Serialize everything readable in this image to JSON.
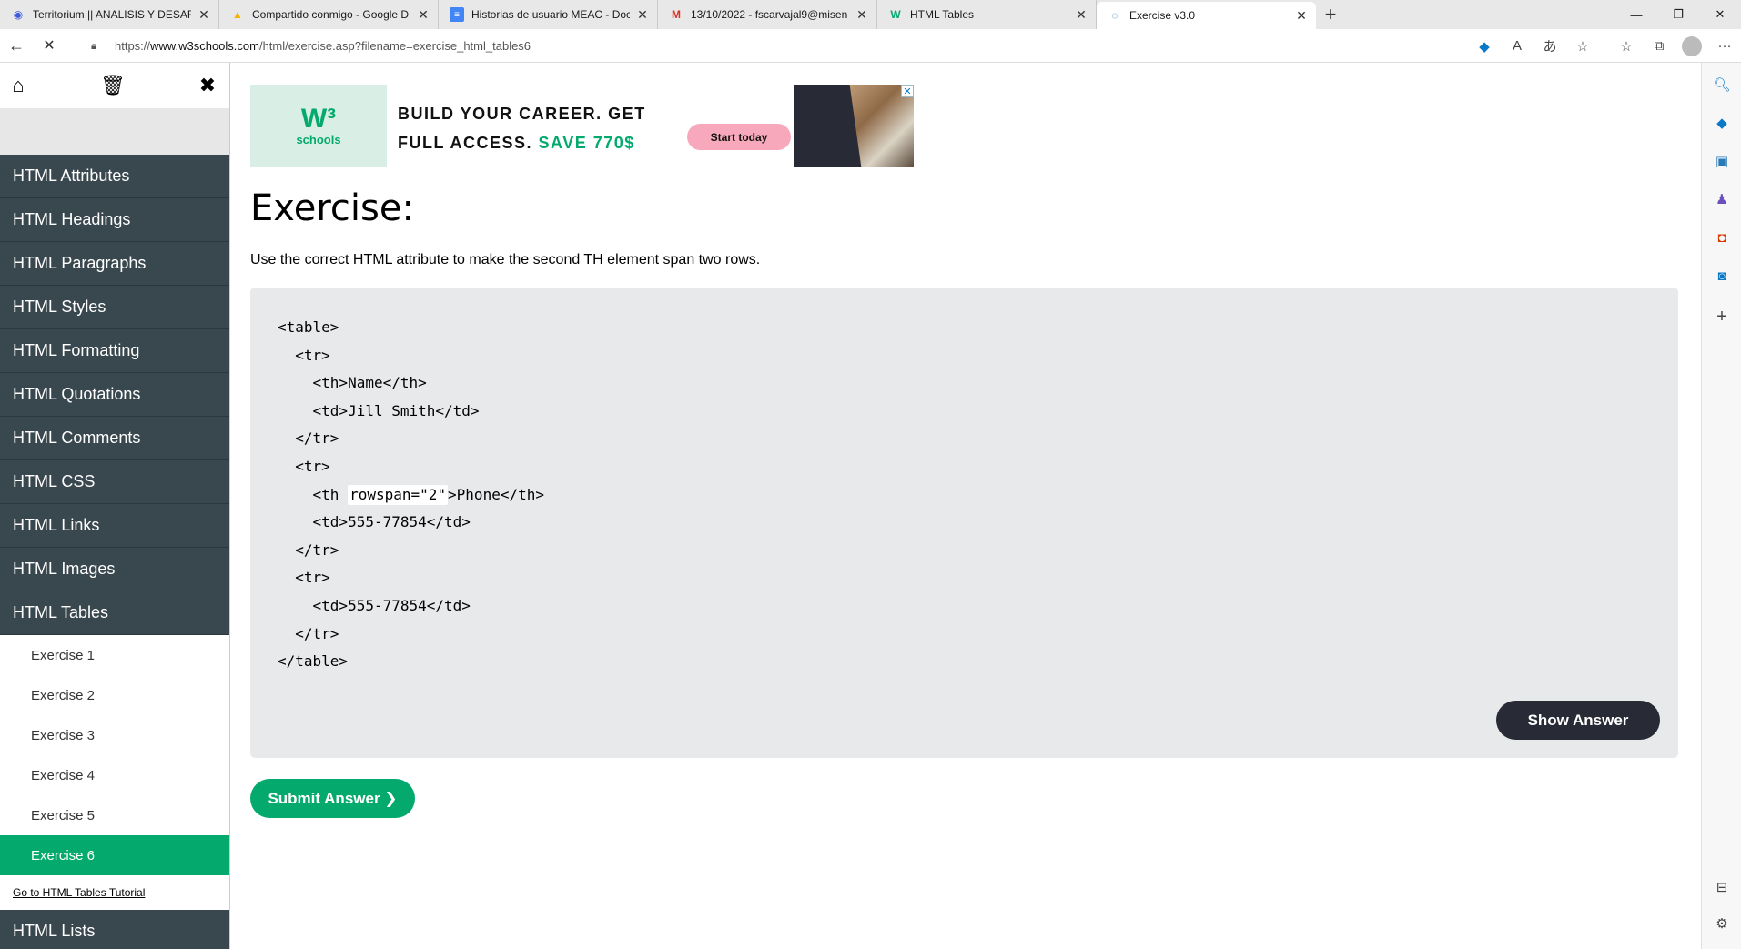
{
  "browser": {
    "tabs": [
      {
        "title": "Territorium || ANALISIS Y DESARR",
        "icon": "eye-icon"
      },
      {
        "title": "Compartido conmigo - Google D",
        "icon": "google-drive-icon"
      },
      {
        "title": "Historias de usuario MEAC - Doc",
        "icon": "google-docs-icon"
      },
      {
        "title": "13/10/2022 - fscarvajal9@misen",
        "icon": "gmail-icon"
      },
      {
        "title": "HTML Tables",
        "icon": "w3schools-icon"
      },
      {
        "title": "Exercise v3.0",
        "icon": "loading-icon"
      }
    ],
    "url_prefix": "https://",
    "url_host": "www.w3schools.com",
    "url_path": "/html/exercise.asp?filename=exercise_html_tables6"
  },
  "sidebar": {
    "sections": [
      "HTML Attributes",
      "HTML Headings",
      "HTML Paragraphs",
      "HTML Styles",
      "HTML Formatting",
      "HTML Quotations",
      "HTML Comments",
      "HTML CSS",
      "HTML Links",
      "HTML Images",
      "HTML Tables"
    ],
    "exercises": [
      "Exercise 1",
      "Exercise 2",
      "Exercise 3",
      "Exercise 4",
      "Exercise 5",
      "Exercise 6"
    ],
    "active_exercise": "Exercise 6",
    "goto_link": "Go to HTML Tables Tutorial",
    "next_section": "HTML Lists"
  },
  "ad": {
    "logo_text": "schools",
    "line1": "BUILD YOUR CAREER. GET",
    "line2_prefix": "FULL ACCESS.",
    "line2_save": "SAVE 770$",
    "cta": "Start today"
  },
  "exercise": {
    "title": "Exercise:",
    "description": "Use the correct HTML attribute to make the second TH element span two rows.",
    "code": {
      "l1": "<table>",
      "l2": "  <tr>",
      "l3": "    <th>Name</th>",
      "l4": "    <td>Jill Smith</td>",
      "l5": "  </tr>",
      "l6": "  <tr>",
      "l7_before": "    <th ",
      "l7_answer": "rowspan=\"2\"",
      "l7_after": ">Phone</th>",
      "l8": "    <td>555-77854</td>",
      "l9": "  </tr>",
      "l10": "  <tr>",
      "l11": "    <td>555-77854</td>",
      "l12": "  </tr>",
      "l13": "</table>"
    },
    "show_answer": "Show Answer",
    "submit": "Submit Answer ❯"
  },
  "colors": {
    "accent_green": "#04aa6d",
    "nav_dark": "#39474e",
    "button_dark": "#282a35",
    "code_bg": "#e7e9eb"
  }
}
